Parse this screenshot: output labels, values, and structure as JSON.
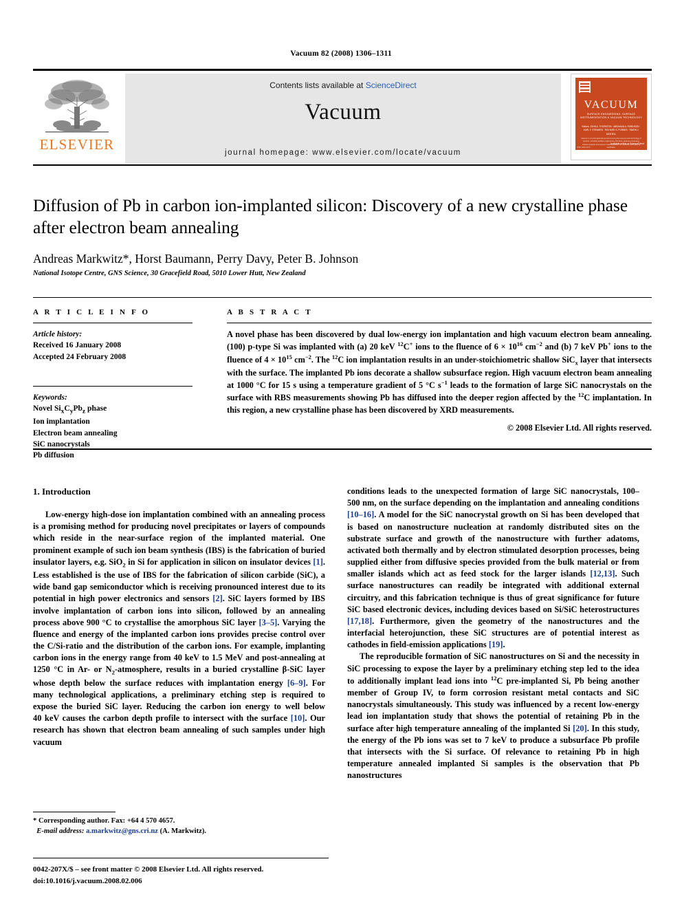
{
  "running_head": "Vacuum 82 (2008) 1306–1311",
  "masthead": {
    "publisher_logo_name": "elsevier-tree-logo",
    "publisher_name": "ELSEVIER",
    "contents_prefix": "Contents lists available at",
    "contents_link": "ScienceDirect",
    "journal_name": "Vacuum",
    "homepage": "journal homepage: www.elsevier.com/locate/vacuum",
    "cover": {
      "title": "VACUUM",
      "subtitle": "SURFACE ENGINEERING, SURFACE INSTRUMENTATION & VACUUM TECHNOLOGY",
      "editors": "Editors: JOHN A. THORNTON · ABRAHAM A. ROBINSON · KARL F. STEWARD · RICHARD G. FORBES · SIMON J. BUSHELL",
      "blurb": "Vacuum is an international journal covering the science and technology of vacuum, including surface engineering, thin films, plasma processing, surface analysis and vacuum instrumentation for research and industry worldwide.",
      "footer_right": "Available online at ScienceDirect",
      "footer_left": "ISSN 0042-207X"
    }
  },
  "article": {
    "title": "Diffusion of Pb in carbon ion-implanted silicon: Discovery of a new crystalline phase after electron beam annealing",
    "authors": "Andreas Markwitz*, Horst Baumann, Perry Davy, Peter B. Johnson",
    "affiliation": "National Isotope Centre, GNS Science, 30 Gracefield Road, 5010 Lower Hutt, New Zealand"
  },
  "article_info": {
    "heading": "A R T I C L E   I N F O",
    "history_label": "Article history:",
    "received": "Received 16 January 2008",
    "accepted": "Accepted 24 February 2008",
    "keywords_label": "Keywords:",
    "keywords": [
      "Novel SixCyPbz phase",
      "Ion implantation",
      "Electron beam annealing",
      "SiC nanocrystals",
      "Pb diffusion"
    ]
  },
  "abstract": {
    "heading": "A B S T R A C T",
    "text": "A novel phase has been discovered by dual low-energy ion implantation and high vacuum electron beam annealing. (100) p-type Si was implanted with (a) 20 keV 12C+ ions to the fluence of 6 × 1016 cm−2 and (b) 7 keV Pb+ ions to the fluence of 4 × 1015 cm−2. The 12C ion implantation results in an under-stoichiometric shallow SiCx layer that intersects with the surface. The implanted Pb ions decorate a shallow subsurface region. High vacuum electron beam annealing at 1000 °C for 15 s using a temperature gradient of 5 °C s−1 leads to the formation of large SiC nanocrystals on the surface with RBS measurements showing Pb has diffused into the deeper region affected by the 12C implantation. In this region, a new crystalline phase has been discovered by XRD measurements.",
    "copyright": "© 2008 Elsevier Ltd. All rights reserved."
  },
  "body": {
    "section_heading": "1. Introduction",
    "left_paragraph_1": "Low-energy high-dose ion implantation combined with an annealing process is a promising method for producing novel precipitates or layers of compounds which reside in the near-surface region of the implanted material. One prominent example of such ion beam synthesis (IBS) is the fabrication of buried insulator layers, e.g. SiO2 in Si for application in silicon on insulator devices [1]. Less established is the use of IBS for the fabrication of silicon carbide (SiC), a wide band gap semiconductor which is receiving pronounced interest due to its potential in high power electronics and sensors [2]. SiC layers formed by IBS involve implantation of carbon ions into silicon, followed by an annealing process above 900 °C to crystallise the amorphous SiC layer [3–5]. Varying the fluence and energy of the implanted carbon ions provides precise control over the C/Si-ratio and the distribution of the carbon ions. For example, implanting carbon ions in the energy range from 40 keV to 1.5 MeV and post-annealing at 1250 °C in Ar- or N2-atmosphere, results in a buried crystalline β-SiC layer whose depth below the surface reduces with implantation energy [6–9]. For many technological applications, a preliminary etching step is required to expose the buried SiC layer. Reducing the carbon ion energy to well below 40 keV causes the carbon depth profile to intersect with the surface [10]. Our research has shown that electron beam annealing of such samples under high vacuum",
    "right_paragraph_1": "conditions leads to the unexpected formation of large SiC nanocrystals, 100–500 nm, on the surface depending on the implantation and annealing conditions [10–16]. A model for the SiC nanocrystal growth on Si has been developed that is based on nanostructure nucleation at randomly distributed sites on the substrate surface and growth of the nanostructure with further adatoms, activated both thermally and by electron stimulated desorption processes, being supplied either from diffusive species provided from the bulk material or from smaller islands which act as feed stock for the larger islands [12,13]. Such surface nanostructures can readily be integrated with additional external circuitry, and this fabrication technique is thus of great significance for future SiC based electronic devices, including devices based on Si/SiC heterostructures [17,18]. Furthermore, given the geometry of the nanostructures and the interfacial heterojunction, these SiC structures are of potential interest as cathodes in field-emission applications [19].",
    "right_paragraph_2": "The reproducible formation of SiC nanostructures on Si and the necessity in SiC processing to expose the layer by a preliminary etching step led to the idea to additionally implant lead ions into 12C pre-implanted Si, Pb being another member of Group IV, to form corrosion resistant metal contacts and SiC nanocrystals simultaneously. This study was influenced by a recent low-energy lead ion implantation study that shows the potential of retaining Pb in the surface after high temperature annealing of the implanted Si [20]. In this study, the energy of the Pb ions was set to 7 keV to produce a subsurface Pb profile that intersects with the Si surface. Of relevance to retaining Pb in high temperature annealed implanted Si samples is the observation that Pb nanostructures"
  },
  "footnote": {
    "corresponding": "* Corresponding author. Fax: +64 4 570 4657.",
    "email_label": "E-mail address:",
    "email": "a.markwitz@gns.cri.nz",
    "email_suffix": "(A. Markwitz)."
  },
  "imprint": {
    "line1": "0042-207X/$ – see front matter © 2008 Elsevier Ltd. All rights reserved.",
    "line2": "doi:10.1016/j.vacuum.2008.02.006"
  },
  "colors": {
    "elsevier_orange": "#e87722",
    "link_blue": "#2a5db0",
    "citation_blue": "#1b3f94",
    "cover_red": "#c8491f",
    "band_gray": "#e6e6e6"
  }
}
